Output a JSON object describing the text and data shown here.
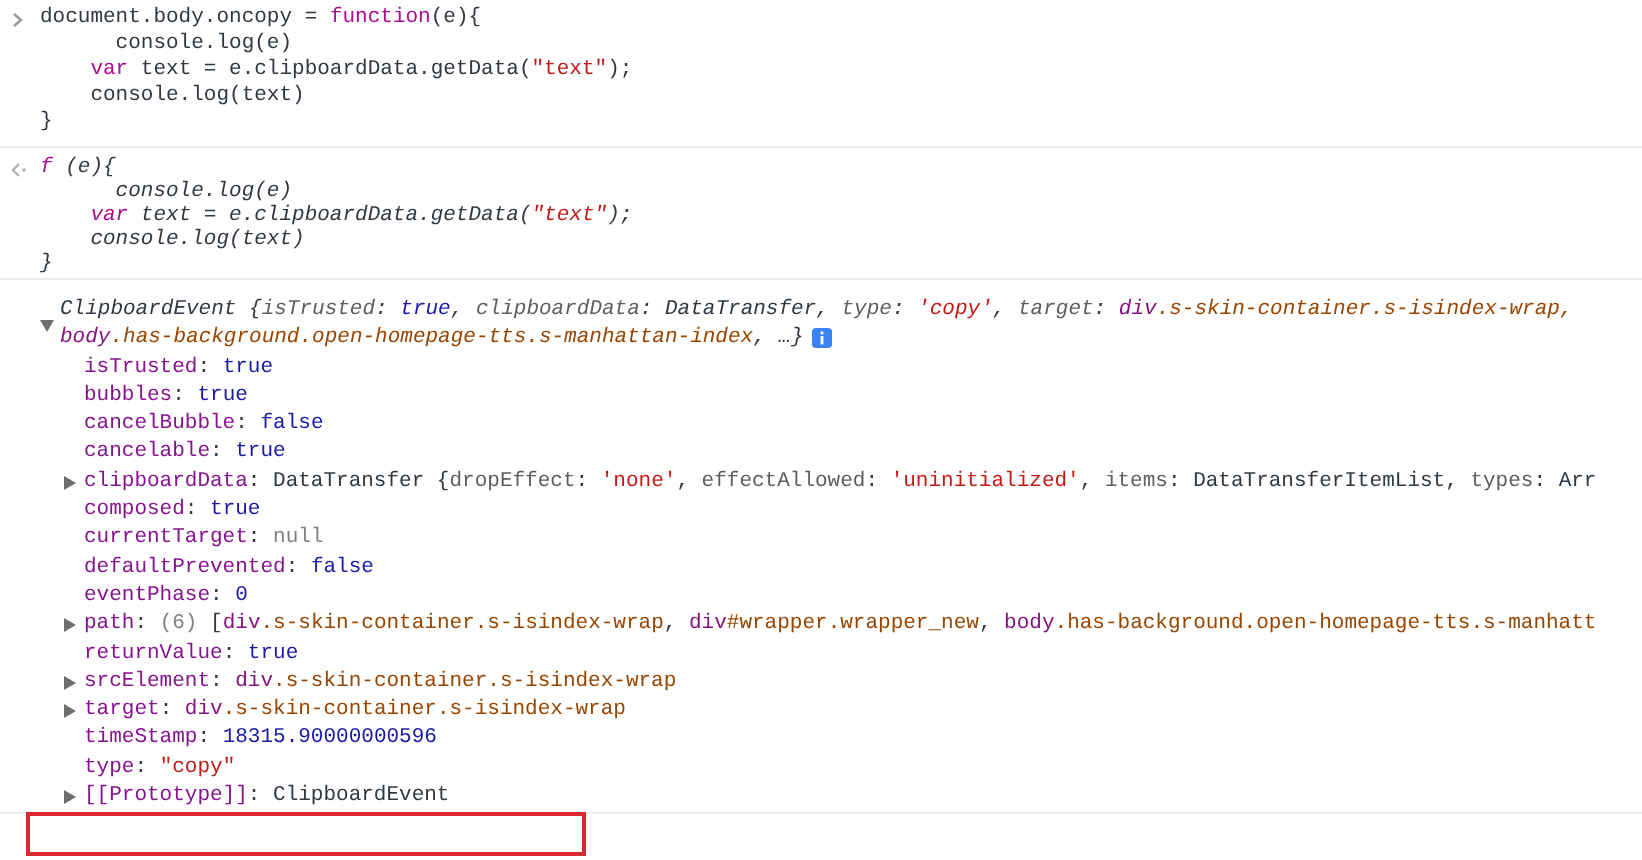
{
  "entries": [
    {
      "kind": "input",
      "lines": [
        [
          {
            "text": "document.body.oncopy = ",
            "kind": "p"
          },
          {
            "text": "function",
            "kind": "kw"
          },
          {
            "text": "(e){",
            "kind": "p"
          }
        ],
        [
          {
            "text": "      console.log(e)",
            "kind": "p"
          }
        ],
        [
          {
            "text": "    var",
            "kind": "kw"
          },
          {
            "text": " text = e.clipboardData.getData(",
            "kind": "p"
          },
          {
            "text": "\"text\"",
            "kind": "str"
          },
          {
            "text": ");",
            "kind": "p"
          }
        ],
        [
          {
            "text": "    console.log(text)",
            "kind": "p"
          }
        ],
        [
          {
            "text": "}",
            "kind": "p"
          }
        ]
      ]
    },
    {
      "kind": "result",
      "lines": [
        [
          {
            "text": "f",
            "kind": "kw"
          },
          {
            "text": " (e){",
            "kind": "p"
          }
        ],
        [
          {
            "text": "      console.log(e)",
            "kind": "p"
          }
        ],
        [
          {
            "text": "    var",
            "kind": "kw"
          },
          {
            "text": " text = e.clipboardData.getData(",
            "kind": "p"
          },
          {
            "text": "\"text\"",
            "kind": "str"
          },
          {
            "text": ");",
            "kind": "p"
          }
        ],
        [
          {
            "text": "    console.log(text)",
            "kind": "p"
          }
        ],
        [
          {
            "text": "}",
            "kind": "p"
          }
        ]
      ]
    },
    {
      "kind": "object",
      "expanded": true,
      "lines": [
        [
          {
            "text": "ClipboardEvent {",
            "kind": "p"
          },
          {
            "text": "isTrusted",
            "kind": "pk"
          },
          {
            "text": ": ",
            "kind": "p"
          },
          {
            "text": "true",
            "kind": "num"
          },
          {
            "text": ", ",
            "kind": "p"
          },
          {
            "text": "clipboardData",
            "kind": "pk"
          },
          {
            "text": ": DataTransfer, ",
            "kind": "p"
          },
          {
            "text": "type",
            "kind": "pk"
          },
          {
            "text": ": ",
            "kind": "p"
          },
          {
            "text": "'copy'",
            "kind": "str"
          },
          {
            "text": ", ",
            "kind": "p"
          },
          {
            "text": "target",
            "kind": "pk"
          },
          {
            "text": ": ",
            "kind": "p"
          },
          {
            "text": "div",
            "kind": "tag"
          },
          {
            "text": ".s-skin-container.s-isindex-wrap, ",
            "kind": "cls"
          }
        ],
        [
          {
            "text": "body",
            "kind": "tag"
          },
          {
            "text": ".has-background.open-homepage-tts.s-manhattan-index",
            "kind": "cls"
          },
          {
            "text": ", …}",
            "kind": "p"
          }
        ]
      ],
      "properties": [
        {
          "expandable": false,
          "segs": [
            {
              "text": "isTrusted",
              "kind": "key"
            },
            {
              "text": ": ",
              "kind": "p"
            },
            {
              "text": "true",
              "kind": "num"
            }
          ]
        },
        {
          "expandable": false,
          "segs": [
            {
              "text": "bubbles",
              "kind": "key"
            },
            {
              "text": ": ",
              "kind": "p"
            },
            {
              "text": "true",
              "kind": "num"
            }
          ]
        },
        {
          "expandable": false,
          "segs": [
            {
              "text": "cancelBubble",
              "kind": "key"
            },
            {
              "text": ": ",
              "kind": "p"
            },
            {
              "text": "false",
              "kind": "num"
            }
          ]
        },
        {
          "expandable": false,
          "segs": [
            {
              "text": "cancelable",
              "kind": "key"
            },
            {
              "text": ": ",
              "kind": "p"
            },
            {
              "text": "true",
              "kind": "num"
            }
          ]
        },
        {
          "expandable": true,
          "segs": [
            {
              "text": "clipboardData",
              "kind": "key"
            },
            {
              "text": ": DataTransfer {",
              "kind": "p"
            },
            {
              "text": "dropEffect",
              "kind": "pk"
            },
            {
              "text": ": ",
              "kind": "p"
            },
            {
              "text": "'none'",
              "kind": "str"
            },
            {
              "text": ", ",
              "kind": "p"
            },
            {
              "text": "effectAllowed",
              "kind": "pk"
            },
            {
              "text": ": ",
              "kind": "p"
            },
            {
              "text": "'uninitialized'",
              "kind": "str"
            },
            {
              "text": ", ",
              "kind": "p"
            },
            {
              "text": "items",
              "kind": "pk"
            },
            {
              "text": ": DataTransferItemList, ",
              "kind": "p"
            },
            {
              "text": "types",
              "kind": "pk"
            },
            {
              "text": ": Arr",
              "kind": "p"
            }
          ]
        },
        {
          "expandable": false,
          "segs": [
            {
              "text": "composed",
              "kind": "key"
            },
            {
              "text": ": ",
              "kind": "p"
            },
            {
              "text": "true",
              "kind": "num"
            }
          ]
        },
        {
          "expandable": false,
          "segs": [
            {
              "text": "currentTarget",
              "kind": "key"
            },
            {
              "text": ": ",
              "kind": "p"
            },
            {
              "text": "null",
              "kind": "null"
            }
          ]
        },
        {
          "expandable": false,
          "segs": [
            {
              "text": "defaultPrevented",
              "kind": "key"
            },
            {
              "text": ": ",
              "kind": "p"
            },
            {
              "text": "false",
              "kind": "num"
            }
          ]
        },
        {
          "expandable": false,
          "segs": [
            {
              "text": "eventPhase",
              "kind": "key"
            },
            {
              "text": ": ",
              "kind": "p"
            },
            {
              "text": "0",
              "kind": "num"
            }
          ]
        },
        {
          "expandable": true,
          "segs": [
            {
              "text": "path",
              "kind": "key"
            },
            {
              "text": ": ",
              "kind": "p"
            },
            {
              "text": "(6)",
              "kind": "null"
            },
            {
              "text": " [",
              "kind": "p"
            },
            {
              "text": "div",
              "kind": "tag"
            },
            {
              "text": ".s-skin-container.s-isindex-wrap",
              "kind": "cls"
            },
            {
              "text": ", ",
              "kind": "p"
            },
            {
              "text": "div",
              "kind": "tag"
            },
            {
              "text": "#wrapper.wrapper_new",
              "kind": "cls"
            },
            {
              "text": ", ",
              "kind": "p"
            },
            {
              "text": "body",
              "kind": "tag"
            },
            {
              "text": ".has-background.open-homepage-tts.s-manhatt",
              "kind": "cls"
            }
          ]
        },
        {
          "expandable": false,
          "segs": [
            {
              "text": "returnValue",
              "kind": "key"
            },
            {
              "text": ": ",
              "kind": "p"
            },
            {
              "text": "true",
              "kind": "num"
            }
          ]
        },
        {
          "expandable": true,
          "segs": [
            {
              "text": "srcElement",
              "kind": "key"
            },
            {
              "text": ": ",
              "kind": "p"
            },
            {
              "text": "div",
              "kind": "tag"
            },
            {
              "text": ".s-skin-container.s-isindex-wrap",
              "kind": "cls"
            }
          ]
        },
        {
          "expandable": true,
          "segs": [
            {
              "text": "target",
              "kind": "key"
            },
            {
              "text": ": ",
              "kind": "p"
            },
            {
              "text": "div",
              "kind": "tag"
            },
            {
              "text": ".s-skin-container.s-isindex-wrap",
              "kind": "cls"
            }
          ]
        },
        {
          "expandable": false,
          "segs": [
            {
              "text": "timeStamp",
              "kind": "key"
            },
            {
              "text": ": ",
              "kind": "p"
            },
            {
              "text": "18315.90000000596",
              "kind": "num"
            }
          ]
        },
        {
          "expandable": false,
          "segs": [
            {
              "text": "type",
              "kind": "key"
            },
            {
              "text": ": ",
              "kind": "p"
            },
            {
              "text": "\"copy\"",
              "kind": "str"
            }
          ]
        },
        {
          "expandable": true,
          "segs": [
            {
              "text": "[[Prototype]]",
              "kind": "key"
            },
            {
              "text": ": ClipboardEvent",
              "kind": "p"
            }
          ]
        }
      ]
    }
  ]
}
